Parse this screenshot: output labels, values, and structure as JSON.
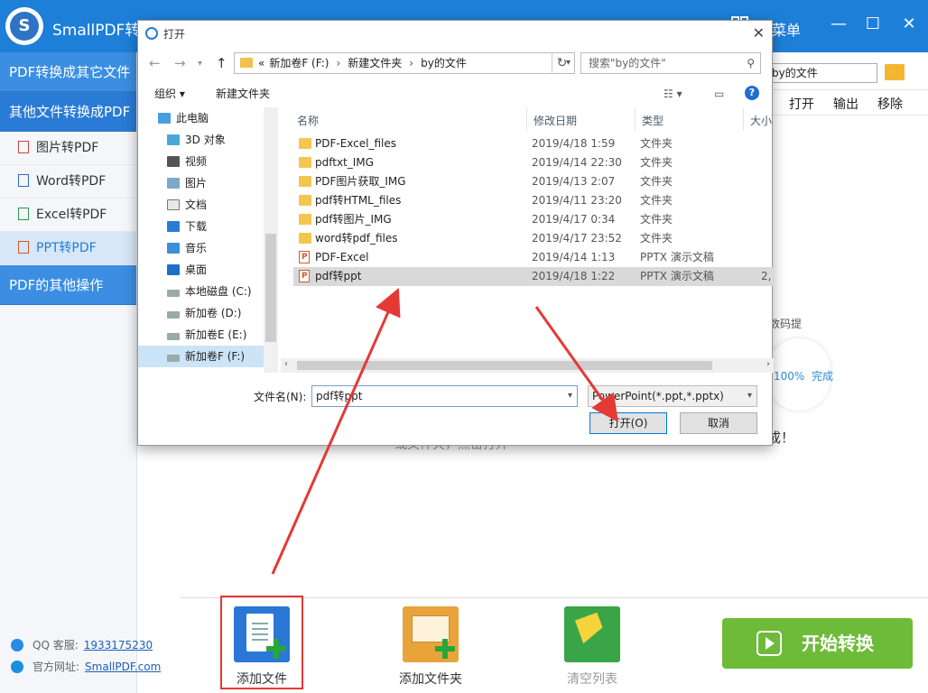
{
  "app": {
    "title": "SmallPDF转换",
    "menu_label": "菜单",
    "path_text": "by的文件",
    "ops": [
      "打开",
      "输出",
      "移除"
    ],
    "bg_text_progress_label": "数码提",
    "bg_pct": "100%",
    "bg_done": "完成",
    "bg_msg": "成！",
    "bg_hint": "或文件夹，点击打开"
  },
  "sidebar": {
    "sections": [
      "PDF转换成其它文件",
      "其他文件转换成PDF",
      "PDF的其他操作"
    ],
    "items": [
      {
        "label": "图片转PDF",
        "icon": "image-icon"
      },
      {
        "label": "Word转PDF",
        "icon": "word-icon"
      },
      {
        "label": "Excel转PDF",
        "icon": "excel-icon"
      },
      {
        "label": "PPT转PDF",
        "icon": "ppt-icon"
      }
    ],
    "qq_label": "QQ 客服:",
    "qq_number": "1933175230",
    "site_label": "官方网址:",
    "site_url": "SmallPDF.com"
  },
  "toolbar": {
    "add_file": "添加文件",
    "add_folder": "添加文件夹",
    "clear_list": "清空列表",
    "start": "开始转换"
  },
  "dialog": {
    "title": "打开",
    "address": [
      "«",
      "新加卷F (F:)",
      "新建文件夹",
      "by的文件"
    ],
    "search_placeholder": "搜索\"by的文件\"",
    "organize": "组织 ▾",
    "new_folder": "新建文件夹",
    "nav": [
      {
        "label": "此电脑",
        "icon": "computer-icon",
        "top": true
      },
      {
        "label": "3D 对象",
        "icon": "cube-icon"
      },
      {
        "label": "视频",
        "icon": "video-icon"
      },
      {
        "label": "图片",
        "icon": "picture-icon"
      },
      {
        "label": "文档",
        "icon": "document-icon"
      },
      {
        "label": "下载",
        "icon": "download-icon"
      },
      {
        "label": "音乐",
        "icon": "music-icon"
      },
      {
        "label": "桌面",
        "icon": "desktop-icon"
      },
      {
        "label": "本地磁盘 (C:)",
        "icon": "drive-icon"
      },
      {
        "label": "新加卷 (D:)",
        "icon": "drive-icon"
      },
      {
        "label": "新加卷E (E:)",
        "icon": "drive-icon"
      },
      {
        "label": "新加卷F (F:)",
        "icon": "drive-icon",
        "selected": true
      }
    ],
    "columns": {
      "name": "名称",
      "date": "修改日期",
      "type": "类型",
      "size": "大小"
    },
    "files": [
      {
        "name": "PDF-Excel_files",
        "date": "2019/4/18 1:59",
        "type": "文件夹",
        "size": "",
        "kind": "folder"
      },
      {
        "name": "pdftxt_IMG",
        "date": "2019/4/14 22:30",
        "type": "文件夹",
        "size": "",
        "kind": "folder"
      },
      {
        "name": "PDF图片获取_IMG",
        "date": "2019/4/13 2:07",
        "type": "文件夹",
        "size": "",
        "kind": "folder"
      },
      {
        "name": "pdf转HTML_files",
        "date": "2019/4/11 23:20",
        "type": "文件夹",
        "size": "",
        "kind": "folder"
      },
      {
        "name": "pdf转图片_IMG",
        "date": "2019/4/17 0:34",
        "type": "文件夹",
        "size": "",
        "kind": "folder"
      },
      {
        "name": "word转pdf_files",
        "date": "2019/4/17 23:52",
        "type": "文件夹",
        "size": "",
        "kind": "folder"
      },
      {
        "name": "PDF-Excel",
        "date": "2019/4/14 1:13",
        "type": "PPTX 演示文稿",
        "size": "",
        "kind": "pptx"
      },
      {
        "name": "pdf转ppt",
        "date": "2019/4/18 1:22",
        "type": "PPTX 演示文稿",
        "size": "2,",
        "kind": "pptx",
        "selected": true
      }
    ],
    "filename_label": "文件名(N):",
    "filename_value": "pdf转ppt",
    "filetype_value": "PowerPoint(*.ppt,*.pptx)",
    "open_btn": "打开(O)",
    "cancel_btn": "取消"
  },
  "colors": {
    "title_blue": "#1e7fd8",
    "start_green": "#6dbb38",
    "highlight_red": "#e53935"
  }
}
